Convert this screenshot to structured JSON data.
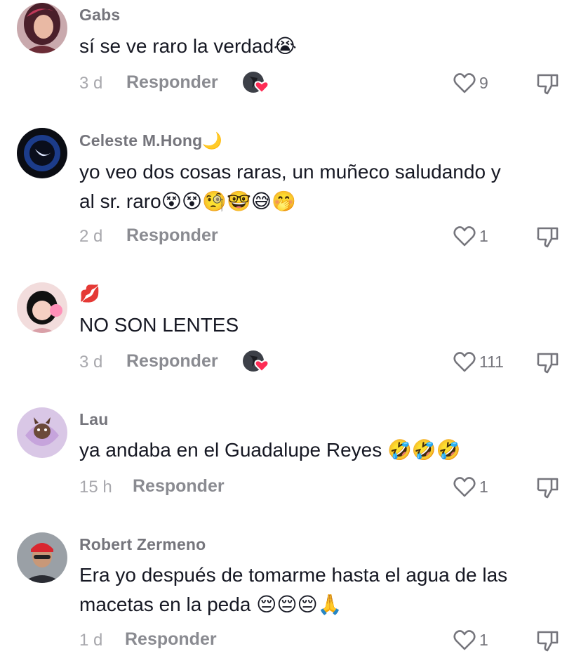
{
  "comments": [
    {
      "username": "Gabs",
      "text": "sí se ve raro la verdad😭",
      "time": "3 d",
      "reply_label": "Responder",
      "likes": "9",
      "creator_liked": true
    },
    {
      "username": "Celeste M.Hong🌙",
      "text": "yo veo dos cosas raras, un muñeco saludando y\nal sr. raro😵😵🧐🤓😅🤭",
      "time": "2 d",
      "reply_label": "Responder",
      "likes": "1",
      "creator_liked": false
    },
    {
      "username": "💋",
      "text": "NO SON LENTES",
      "time": "3 d",
      "reply_label": "Responder",
      "likes": "111",
      "creator_liked": true
    },
    {
      "username": "Lau",
      "text": "ya andaba en el Guadalupe Reyes 🤣🤣🤣",
      "time": "15 h",
      "reply_label": "Responder",
      "likes": "1",
      "creator_liked": false
    },
    {
      "username": "Robert Zermeno",
      "text": "Era yo después de tomarme hasta el agua de las\nmacetas en la peda 😔😔😔🙏",
      "time": "1 d",
      "reply_label": "Responder",
      "likes": "1",
      "creator_liked": false
    }
  ],
  "icons": {
    "like": "heart-outline-icon",
    "dislike": "thumbs-down-icon",
    "creator_liked": "creator-heart-badge-icon"
  },
  "colors": {
    "text": "#161823",
    "muted": "#75757c",
    "creator_heart": "#fe2c55"
  }
}
